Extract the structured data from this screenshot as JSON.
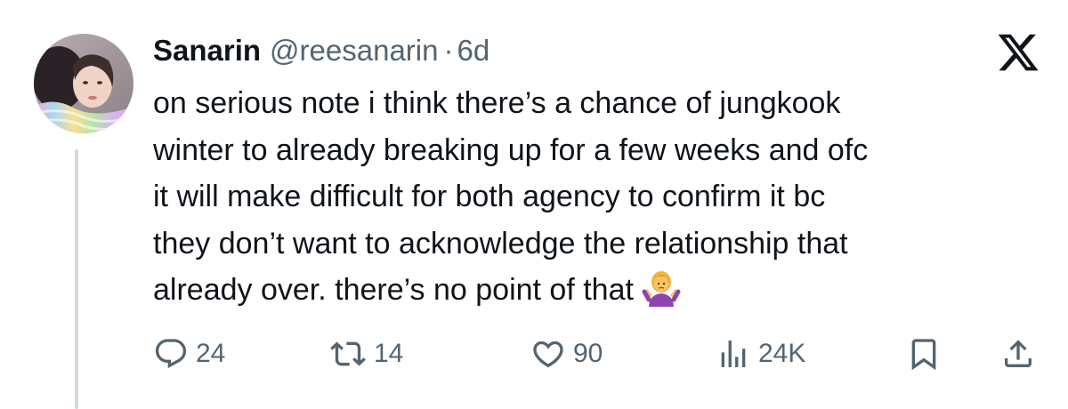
{
  "tweet": {
    "display_name": "Sanarin",
    "handle": "@reesanarin",
    "separator": "·",
    "time": "6d",
    "text_lines": [
      "on serious note i think there’s a chance of jungkook",
      "winter to already breaking up for a few weeks and ofc",
      "it will make difficult for both agency to confirm it bc",
      "they don’t want to acknowledge the relationship that",
      "already over. there’s no point of that"
    ],
    "emoji": "person-shrugging-emoji"
  },
  "actions": {
    "replies": "24",
    "reposts": "14",
    "likes": "90",
    "views": "24K"
  },
  "icons": {
    "reply": "reply-icon",
    "repost": "repost-icon",
    "like": "heart-icon",
    "views": "views-icon",
    "bookmark": "bookmark-icon",
    "share": "share-icon",
    "logo": "x-logo-icon"
  },
  "colors": {
    "text": "#0f1419",
    "secondary": "#536471",
    "thread_line": "#cfd9de"
  }
}
